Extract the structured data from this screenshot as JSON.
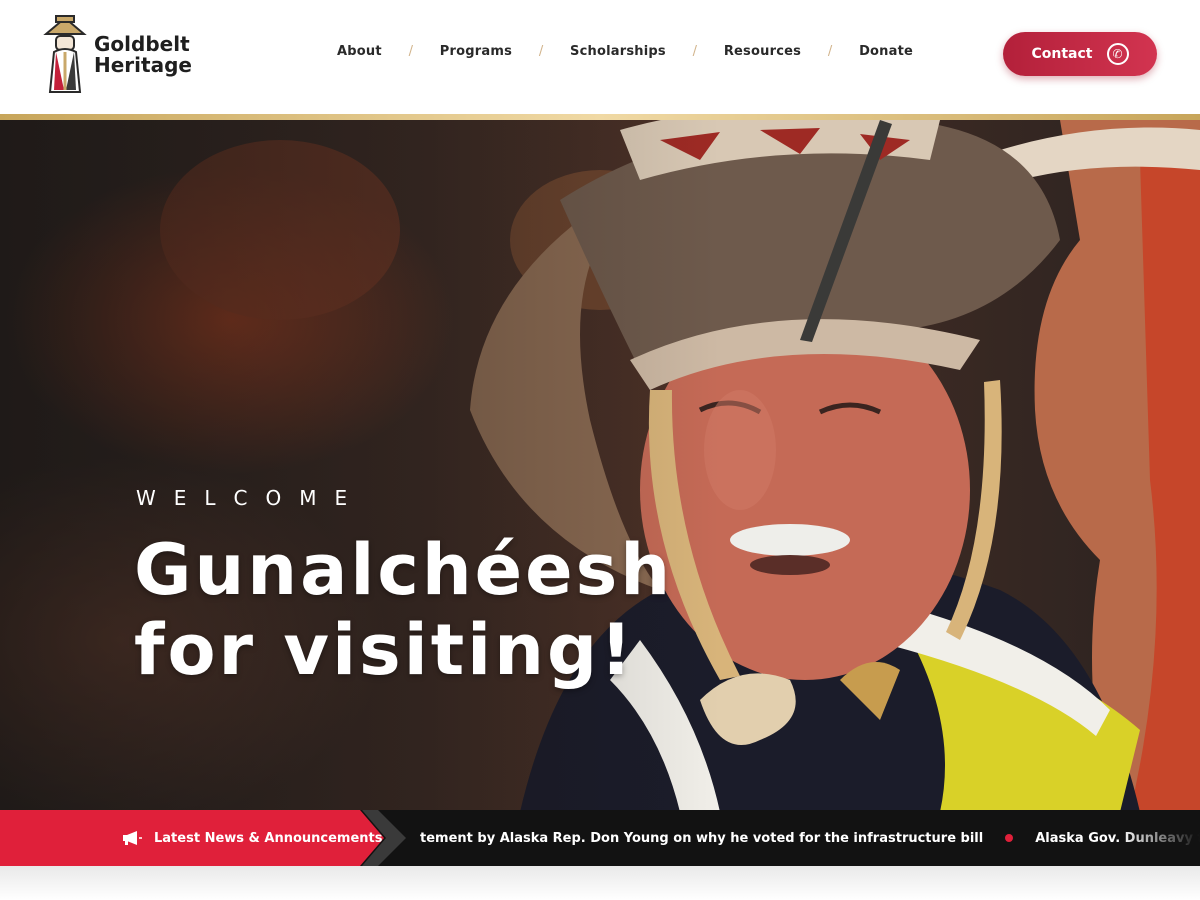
{
  "brand": {
    "name_line1": "Goldbelt",
    "name_line2": "Heritage"
  },
  "nav": {
    "items": [
      {
        "label": "About"
      },
      {
        "label": "Programs"
      },
      {
        "label": "Scholarships"
      },
      {
        "label": "Resources"
      },
      {
        "label": "Donate"
      }
    ],
    "separator": "/"
  },
  "contact": {
    "label": "Contact",
    "icon": "phone-icon"
  },
  "hero": {
    "kicker": "WELCOME",
    "headline_line1": "Gunalchéesh",
    "headline_line2": "for visiting!"
  },
  "news": {
    "label": "Latest News & Announcements",
    "icon": "megaphone-icon",
    "items": [
      "tement by Alaska Rep. Don Young on why he voted for the infrastructure bill",
      "Alaska Gov. Dunleavy forbids state agen"
    ]
  },
  "colors": {
    "accent_red": "#e0203a",
    "contact_red": "#c4283f",
    "gold": "#d2b48c",
    "news_bg": "#121212"
  }
}
